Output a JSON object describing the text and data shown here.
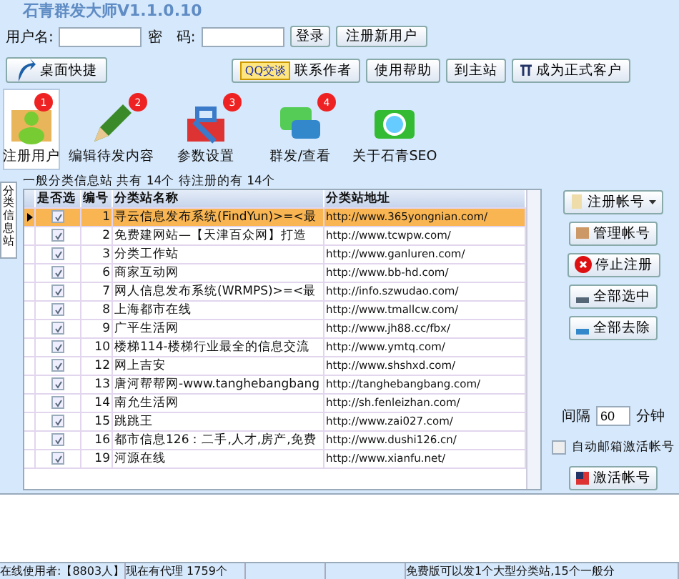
{
  "window": {
    "title": "石青群发大师V1.1.0.10"
  },
  "login": {
    "username_label": "用户名:",
    "password_label": "密　码:",
    "login_button": "登录",
    "register_button": "注册新用户"
  },
  "toolbar": {
    "left": [
      {
        "kind": "shortcut",
        "label": "桌面快捷"
      }
    ],
    "right": [
      {
        "kind": "qq",
        "badge": "QQ交谈",
        "label": "联系作者"
      },
      {
        "kind": "plain",
        "label": "使用帮助"
      },
      {
        "kind": "plain",
        "label": "到主站"
      },
      {
        "kind": "pi",
        "label": "成为正式客户"
      }
    ]
  },
  "modules": [
    {
      "kind": "user",
      "label": "注册用户",
      "badge": "1",
      "selected": true
    },
    {
      "kind": "pencil",
      "label": "编辑待发内容",
      "badge": "2",
      "selected": false
    },
    {
      "kind": "toolbox",
      "label": "参数设置",
      "badge": "3",
      "selected": false
    },
    {
      "kind": "chat",
      "label": "群发/查看",
      "badge": "4",
      "selected": false
    },
    {
      "kind": "camera",
      "label": "关于石青SEO",
      "selected": false
    }
  ],
  "side_tab": "分类信息站",
  "group": {
    "title": "一般分类信息站 共有 14个 待注册的有 14个"
  },
  "table": {
    "columns": [
      "是否选",
      "编号",
      "分类站名称",
      "分类站地址"
    ],
    "rows": [
      {
        "checked": true,
        "selected": true,
        "number": "1",
        "name": "寻云信息发布系统(FindYun)>=<最",
        "url": "http://www.365yongnian.com/"
      },
      {
        "checked": true,
        "selected": false,
        "number": "2",
        "name": "免费建网站—【天津百众网】打造",
        "url": "http://www.tcwpw.com/"
      },
      {
        "checked": true,
        "selected": false,
        "number": "3",
        "name": "分类工作站",
        "url": "http://www.ganluren.com/"
      },
      {
        "checked": true,
        "selected": false,
        "number": "6",
        "name": "商家互动网",
        "url": "http://www.bb-hd.com/"
      },
      {
        "checked": true,
        "selected": false,
        "number": "7",
        "name": "网人信息发布系统(WRMPS)>=<最",
        "url": "http://info.szwudao.com/"
      },
      {
        "checked": true,
        "selected": false,
        "number": "8",
        "name": "上海都市在线",
        "url": "http://www.tmallcw.com/"
      },
      {
        "checked": true,
        "selected": false,
        "number": "9",
        "name": "广平生活网",
        "url": "http://www.jh88.cc/fbx/"
      },
      {
        "checked": true,
        "selected": false,
        "number": "10",
        "name": "楼梯114-楼梯行业最全的信息交流",
        "url": "http://www.ymtq.com/"
      },
      {
        "checked": true,
        "selected": false,
        "number": "12",
        "name": "网上吉安",
        "url": "http://www.shshxd.com/"
      },
      {
        "checked": true,
        "selected": false,
        "number": "13",
        "name": "唐河帮帮网-www.tanghebangbang",
        "url": "http://tanghebangbang.com/"
      },
      {
        "checked": true,
        "selected": false,
        "number": "14",
        "name": "南允生活网",
        "url": "http://sh.fenleizhan.com/"
      },
      {
        "checked": true,
        "selected": false,
        "number": "15",
        "name": "跳跳王",
        "url": "http://www.zai027.com/"
      },
      {
        "checked": true,
        "selected": false,
        "number": "16",
        "name": "都市信息126：二手,人才,房产,免费",
        "url": "http://www.dushi126.cn/"
      },
      {
        "checked": true,
        "selected": false,
        "number": "19",
        "name": "河源在线",
        "url": "http://www.xianfu.net/"
      }
    ]
  },
  "actions": [
    {
      "kind": "register",
      "label": "注册帐号",
      "dropdown": true
    },
    {
      "kind": "manage",
      "label": "管理帐号"
    },
    {
      "kind": "stop",
      "label": "停止注册"
    },
    {
      "kind": "select",
      "label": "全部选中"
    },
    {
      "kind": "clear",
      "label": "全部去除"
    }
  ],
  "interval": {
    "label": "间隔",
    "value": "60",
    "unit": "分钟"
  },
  "auto_activate": {
    "label": "自动邮箱激活帐号",
    "checked": false
  },
  "activate_button": "激活帐号",
  "status_bar": [
    "在线使用者:【8803人】",
    "现在有代理 1759个",
    "免费版可以发1个大型分类站,15个一般分"
  ]
}
